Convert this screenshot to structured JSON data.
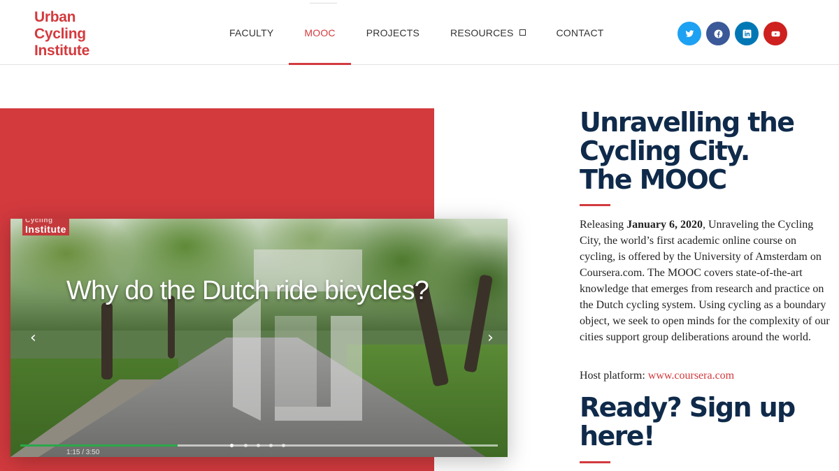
{
  "brand": {
    "logo_lines": [
      "Urban",
      "Cycling",
      "Institute"
    ],
    "accent": "#d33a3e",
    "navy": "#0f2a4a"
  },
  "nav": {
    "items": [
      {
        "label": "FACULTY",
        "active": false
      },
      {
        "label": "MOOC",
        "active": true
      },
      {
        "label": "PROJECTS",
        "active": false
      },
      {
        "label": "RESOURCES",
        "active": false,
        "has_dropdown": true
      },
      {
        "label": "CONTACT",
        "active": false
      }
    ]
  },
  "social": [
    {
      "name": "twitter-icon",
      "color": "#1da1f2"
    },
    {
      "name": "facebook-icon",
      "color": "#3b5998"
    },
    {
      "name": "linkedin-icon",
      "color": "#0077b5"
    },
    {
      "name": "youtube-icon",
      "color": "#cd201f"
    }
  ],
  "video": {
    "overlay_logo_top": "Cycling",
    "overlay_logo": "Institute",
    "title": "Why do the Dutch ride bicycles?",
    "prev_arrow": "‹",
    "next_arrow": "›",
    "progress": 0.33,
    "time": "1:15 / 3:50"
  },
  "main": {
    "heading_lines": [
      "Unravelling the",
      "Cycling City.",
      "The MOOC"
    ],
    "para_prefix": "Releasing ",
    "para_date": "January 6, 2020",
    "para_rest": ", Unraveling the Cycling City, the world’s first academic online course on cycling, is offered by the University of Amsterdam on Coursera.com. The MOOC covers state-of-the-art knowledge that emerges from research and practice on the Dutch cycling system. Using cycling as a boundary object, we seek to open minds for the complexity of our cities support group deliberations around the world.",
    "host_label": "Host platform: ",
    "host_link": "www.coursera.com",
    "signup_lines": [
      "Ready? Sign up",
      "here!"
    ]
  }
}
